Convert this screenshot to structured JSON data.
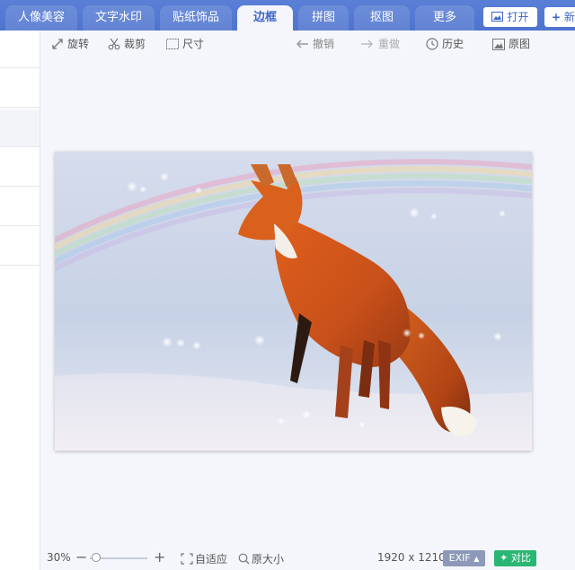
{
  "tabs": [
    {
      "label": "人像美容"
    },
    {
      "label": "文字水印"
    },
    {
      "label": "贴纸饰品"
    },
    {
      "label": "边框"
    },
    {
      "label": "拼图"
    },
    {
      "label": "抠图"
    },
    {
      "label": "更多"
    }
  ],
  "header": {
    "open_label": "打开",
    "new_label": "新"
  },
  "toolbar": {
    "rotate": "旋转",
    "crop": "裁剪",
    "size": "尺寸",
    "undo": "撤销",
    "redo": "重做",
    "history": "历史",
    "original": "原图"
  },
  "canvas": {
    "image_subject": "red fox in snow with rainbow"
  },
  "statusbar": {
    "zoom": "30%",
    "zoom_minus": "−",
    "zoom_plus": "+",
    "zoom_fraction": 0.08,
    "fit_label": "自适应",
    "original_size_label": "原大小",
    "dimensions": "1920 x 1210",
    "exif_label": "EXIF",
    "exif_arrow": "▲",
    "compare_label": "对比"
  },
  "colors": {
    "accent": "#4f74cf",
    "active_tab_text": "#3d66c8",
    "compare_green": "#2bb673",
    "exif_gray": "#8c99b8"
  }
}
